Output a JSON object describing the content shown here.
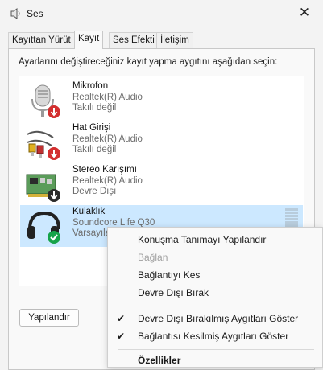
{
  "window": {
    "title": "Ses",
    "close_symbol": "✕"
  },
  "tabs": [
    {
      "label": "Kayıttan Yürüt",
      "active": false
    },
    {
      "label": "Kayıt",
      "active": true
    },
    {
      "label": "Ses Efekti",
      "active": false
    },
    {
      "label": "İletişim",
      "active": false
    }
  ],
  "instruction": "Ayarlarını değiştireceğiniz kayıt yapma aygıtını aşağıdan seçin:",
  "devices": [
    {
      "name": "Mikrofon",
      "driver": "Realtek(R) Audio",
      "status": "Takılı değil",
      "icon": "microphone-icon",
      "badge": "red-down-arrow"
    },
    {
      "name": "Hat Girişi",
      "driver": "Realtek(R) Audio",
      "status": "Takılı değil",
      "icon": "line-in-cable-icon",
      "badge": "red-down-arrow"
    },
    {
      "name": "Stereo Karışımı",
      "driver": "Realtek(R) Audio",
      "status": "Devre Dışı",
      "icon": "sound-card-icon",
      "badge": "black-down-arrow"
    },
    {
      "name": "Kulaklık",
      "driver": "Soundcore Life Q30",
      "status": "Varsayılan",
      "icon": "headset-icon",
      "badge": "green-check",
      "selected": true
    }
  ],
  "buttons": {
    "configure": "Yapılandır"
  },
  "context_menu": {
    "items": [
      {
        "label": "Konuşma Tanımayı Yapılandır",
        "enabled": true
      },
      {
        "label": "Bağlan",
        "enabled": false
      },
      {
        "label": "Bağlantıyı Kes",
        "enabled": true
      },
      {
        "label": "Devre Dışı Bırak",
        "enabled": true
      },
      {
        "label": "Devre Dışı Bırakılmış Aygıtları Göster",
        "enabled": true,
        "checked": true
      },
      {
        "label": "Bağlantısı Kesilmiş Aygıtları Göster",
        "enabled": true,
        "checked": true
      },
      {
        "label": "Özellikler",
        "enabled": true,
        "bold": true
      }
    ],
    "check_symbol": "✔"
  },
  "colors": {
    "selection": "#cce8ff",
    "error_badge": "#d32f2f",
    "default_badge": "#16a34a"
  }
}
